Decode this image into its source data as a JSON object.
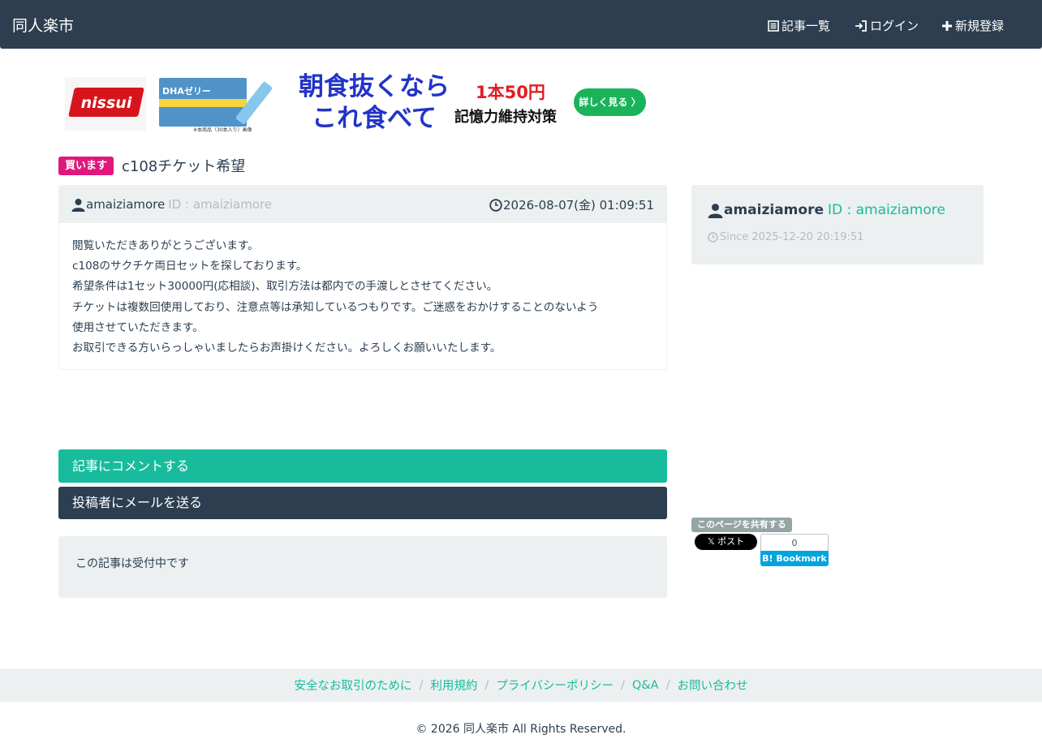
{
  "site": {
    "brand": "同人楽市"
  },
  "nav": {
    "articles_label": "記事一覧",
    "login_label": "ログイン",
    "register_label": "新規登録"
  },
  "ad": {
    "logo_text": "nissui",
    "product_label": "DHAゼリー",
    "product_note": "※本商品（30本入り）画像",
    "headline_1": "朝食抜くなら",
    "headline_2": "これ食べて",
    "price": "1本50円",
    "subline": "記憶力維持対策",
    "cta": "詳しく見る 〉"
  },
  "post": {
    "type_badge": "買います",
    "title": "c108チケット希望",
    "author_name": "amaiziamore",
    "author_id_text": "ID : amaiziamore",
    "datetime": "2026-08-07(金) 01:09:51",
    "body_lines": [
      "閲覧いただきありがとうございます。",
      "c108のサクチケ両日セットを探しております。",
      "希望条件は1セット30000円(応相談)、取引方法は都内での手渡しとさせてください。",
      "チケットは複数回使用しており、注意点等は承知しているつもりです。ご迷惑をおかけすることのないよう",
      "使用させていただきます。",
      "お取引できる方いらっしゃいましたらお声掛けください。よろしくお願いいたします。"
    ]
  },
  "actions": {
    "comment_label": "記事にコメントする",
    "mail_label": "投稿者にメールを送る",
    "status_text": "この記事は受付中です"
  },
  "profile": {
    "name": "amaiziamore",
    "id_text": "ID : amaiziamore",
    "since": "Since 2025-12-20 20:19:51"
  },
  "share": {
    "label": "このページを共有する",
    "x_label": "𝕏 ポスト",
    "hatena_count": "0",
    "hatena_label": "B! Bookmark"
  },
  "footer": {
    "links": [
      "安全なお取引のために",
      "利用規約",
      "プライバシーポリシー",
      "Q&A",
      "お問い合わせ"
    ],
    "copyright": "© 2026 同人楽市 All Rights Reserved."
  },
  "colors": {
    "navbar": "#2c3e50",
    "accent": "#18bc9c",
    "buy_badge": "#e0187c",
    "well": "#ecf0f1"
  },
  "icons": {
    "nav_articles": "list-icon",
    "nav_login": "sign-in-icon",
    "nav_register": "plus-icon",
    "author": "user-icon",
    "datetime": "clock-icon"
  }
}
